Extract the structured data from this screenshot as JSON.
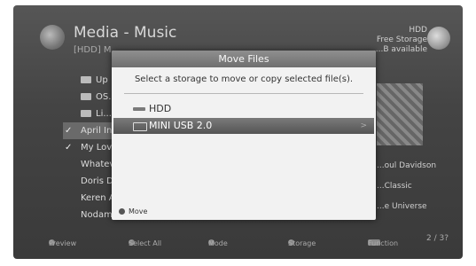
{
  "background": {
    "title": "Media - Music",
    "subtitle": "[HDD] M...",
    "storage_label": "HDD",
    "storage_free": "Free Storage",
    "storage_value": "...B available",
    "list": [
      {
        "label": "Up",
        "folder": true,
        "checked": false
      },
      {
        "label": "OS...",
        "folder": true,
        "checked": false
      },
      {
        "label": "Li...",
        "folder": true,
        "checked": false
      },
      {
        "label": "April In...",
        "folder": false,
        "checked": true,
        "selected": true
      },
      {
        "label": "My Lov...",
        "folder": false,
        "checked": true
      },
      {
        "label": "Whatev...",
        "folder": false,
        "checked": false
      },
      {
        "label": "Doris D...",
        "folder": false,
        "checked": false
      },
      {
        "label": "Keren A...",
        "folder": false,
        "checked": false
      },
      {
        "label": "Nodam...",
        "folder": false,
        "checked": false
      }
    ],
    "details": [
      "...oul Davidson",
      "...Classic",
      "...e Universe"
    ],
    "page": "2 / 3?",
    "footer": [
      "Preview",
      "Select All",
      "Mode",
      "Storage",
      "Function"
    ]
  },
  "dialog": {
    "title": "Move Files",
    "message": "Select a storage to move or copy selected file(s).",
    "options": [
      {
        "label": "HDD",
        "icon": "hdd-icon",
        "selected": false
      },
      {
        "label": "MINI USB 2.0",
        "icon": "usb-icon",
        "selected": true,
        "chevron": ">"
      }
    ],
    "footer_label": "Move"
  }
}
